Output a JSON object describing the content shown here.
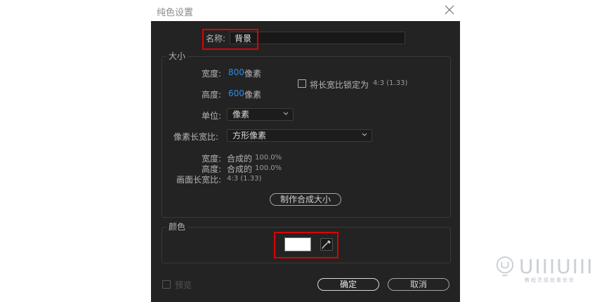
{
  "dialog": {
    "title": "纯色设置",
    "name_label": "名称:",
    "name_value": "背景",
    "size": {
      "group_title": "大小",
      "width_label": "宽度:",
      "width_value": "800",
      "width_unit": "像素",
      "height_label": "高度:",
      "height_value": "600",
      "height_unit": "像素",
      "lock_label": "将长宽比锁定为",
      "lock_ratio": "4:3 (1.33)",
      "units_label": "单位:",
      "units_value": "像素",
      "par_label": "像素长宽比:",
      "par_value": "方形像素",
      "comp_width_label": "宽度:",
      "comp_width_value": "合成的",
      "comp_width_pct": "100.0%",
      "comp_height_label": "高度:",
      "comp_height_value": "合成的",
      "comp_height_pct": "100.0%",
      "frame_ratio_label": "画面长宽比:",
      "frame_ratio_value": "4:3 (1.33)",
      "make_comp_size_label": "制作合成大小"
    },
    "color": {
      "group_title": "颜色",
      "swatch_color": "#ffffff"
    },
    "preview_label": "预览",
    "ok_label": "确定",
    "cancel_label": "取消"
  },
  "watermark": {
    "text": "UIIIUIII",
    "subtext": "教程灵感就看优优"
  }
}
